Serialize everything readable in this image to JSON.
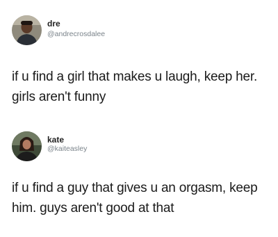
{
  "tweets": [
    {
      "display_name": "dre",
      "handle": "@andrecrosdalee",
      "text": "if u find a girl that makes u laugh, keep her. girls aren't funny",
      "avatar_icon": "user-photo-avatar"
    },
    {
      "display_name": "kate",
      "handle": "@kaiteasley",
      "text": "if u find a guy that gives u an orgasm, keep him. guys aren't good at that",
      "avatar_icon": "user-photo-avatar"
    }
  ]
}
